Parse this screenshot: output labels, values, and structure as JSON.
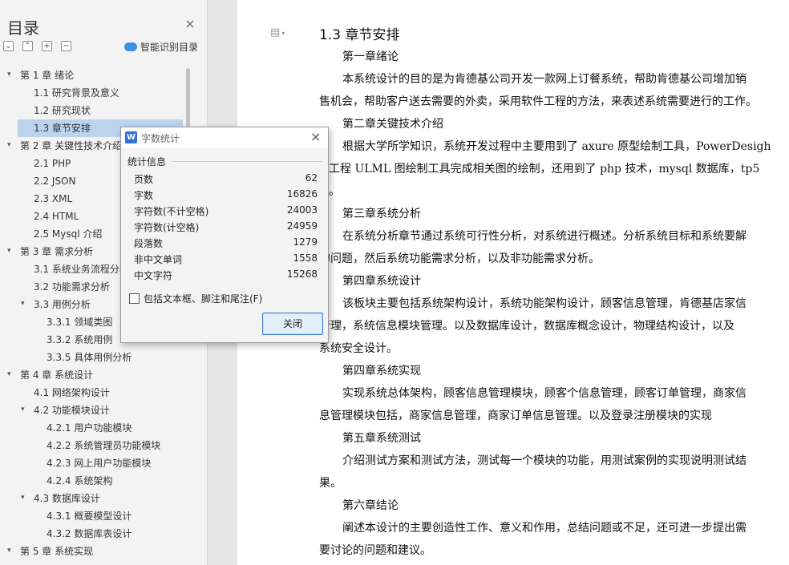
{
  "sidebar": {
    "title": "目录",
    "smart_toc_label": "智能识别目录",
    "items": [
      {
        "label": "第 1 章  绪论"
      },
      {
        "label": "1.1 研究背景及意义"
      },
      {
        "label": "1.2 研究现状"
      },
      {
        "label": "1.3 章节安排",
        "selected": true
      },
      {
        "label": "第 2 章  关键性技术介绍"
      },
      {
        "label": "2.1 PHP"
      },
      {
        "label": "2.2 JSON"
      },
      {
        "label": "2.3 XML"
      },
      {
        "label": "2.4 HTML"
      },
      {
        "label": "2.5 Mysql 介绍"
      },
      {
        "label": "第 3 章  需求分析"
      },
      {
        "label": "3.1  系统业务流程分析"
      },
      {
        "label": "3.2  功能需求分析"
      },
      {
        "label": "3.3 用例分析"
      },
      {
        "label": "3.3.1 领域类图"
      },
      {
        "label": "3.3.2 系统用例"
      },
      {
        "label": "3.3.5 具体用例分析"
      },
      {
        "label": "第 4 章  系统设计"
      },
      {
        "label": "4.1  网络架构设计"
      },
      {
        "label": "4.2  功能模块设计"
      },
      {
        "label": "4.2.1  用户功能模块"
      },
      {
        "label": "4.2.2  系统管理员功能模块"
      },
      {
        "label": "4.2.3  网上用户功能模块"
      },
      {
        "label": "4.2.4  系统架构"
      },
      {
        "label": "4.3  数据库设计"
      },
      {
        "label": "4.3.1  概要模型设计"
      },
      {
        "label": "4.3.2  数据库表设计"
      },
      {
        "label": "第 5 章  系统实现"
      }
    ]
  },
  "document": {
    "heading": "1.3 章节安排",
    "lines": [
      "第一章绪论",
      "本系统设计的目的是为肯德基公司开发一款网上订餐系统，帮助肯德基公司增加销",
      "售机会，帮助客户送去需要的外卖，采用软件工程的方法，来表述系统需要进行的工作。",
      "第二章关键技术介绍",
      "根据大学所学知识，系统开发过程中主要用到了 axure 原型绘制工具，PowerDesigh",
      "件工程 ULML 图绘制工具完成相关图的绘制，还用到了 php 技术，mysql 数据库，tp5",
      "架。",
      "第三章系统分析",
      "在系统分析章节通过系统可行性分析，对系统进行概述。分析系统目标和系统要解",
      "的问题，然后系统功能需求分析，以及非功能需求分析。",
      "第四章系统设计",
      "该板块主要包括系统架构设计，系统功能架构设计，顾客信息管理，肯德基店家信",
      "管理，系统信息模块管理。以及数据库设计，数据库概念设计，物理结构设计，以及",
      "系统安全设计。",
      "第四章系统实现",
      "实现系统总体架构，顾客信息管理模块，顾客个信息管理，顾客订单管理，商家信",
      "息管理模块包括，商家信息管理，商家订单信息管理。以及登录注册模块的实现",
      "第五章系统测试",
      "介绍测试方案和测试方法，测试每一个模块的功能，用测试案例的实现说明测试结",
      "果。",
      "第六章结论",
      "阐述本设计的主要创造性工作、意义和作用，总结问题或不足，还可进一步提出需",
      "要讨论的问题和建议。"
    ]
  },
  "dialog": {
    "title": "字数统计",
    "icon_letter": "W",
    "group_label": "统计信息",
    "stats": [
      {
        "label": "页数",
        "value": "62"
      },
      {
        "label": "字数",
        "value": "16826"
      },
      {
        "label": "字符数(不计空格)",
        "value": "24003"
      },
      {
        "label": "字符数(计空格)",
        "value": "24959"
      },
      {
        "label": "段落数",
        "value": "1279"
      },
      {
        "label": "非中文单词",
        "value": "1558"
      },
      {
        "label": "中文字符",
        "value": "15268"
      }
    ],
    "include_label": "包括文本框、脚注和尾注(F)",
    "include_checked": false,
    "close_label": "关闭"
  },
  "colors": {
    "selection": "#bcd3ee",
    "accent": "#2f6fde",
    "smart_icon": "#3b8fe8"
  },
  "icons": {
    "sidebar_close": "close-icon",
    "smart_toc": "cloud-icon",
    "doc_menu": "document-icon",
    "dialog_close": "close-icon"
  }
}
